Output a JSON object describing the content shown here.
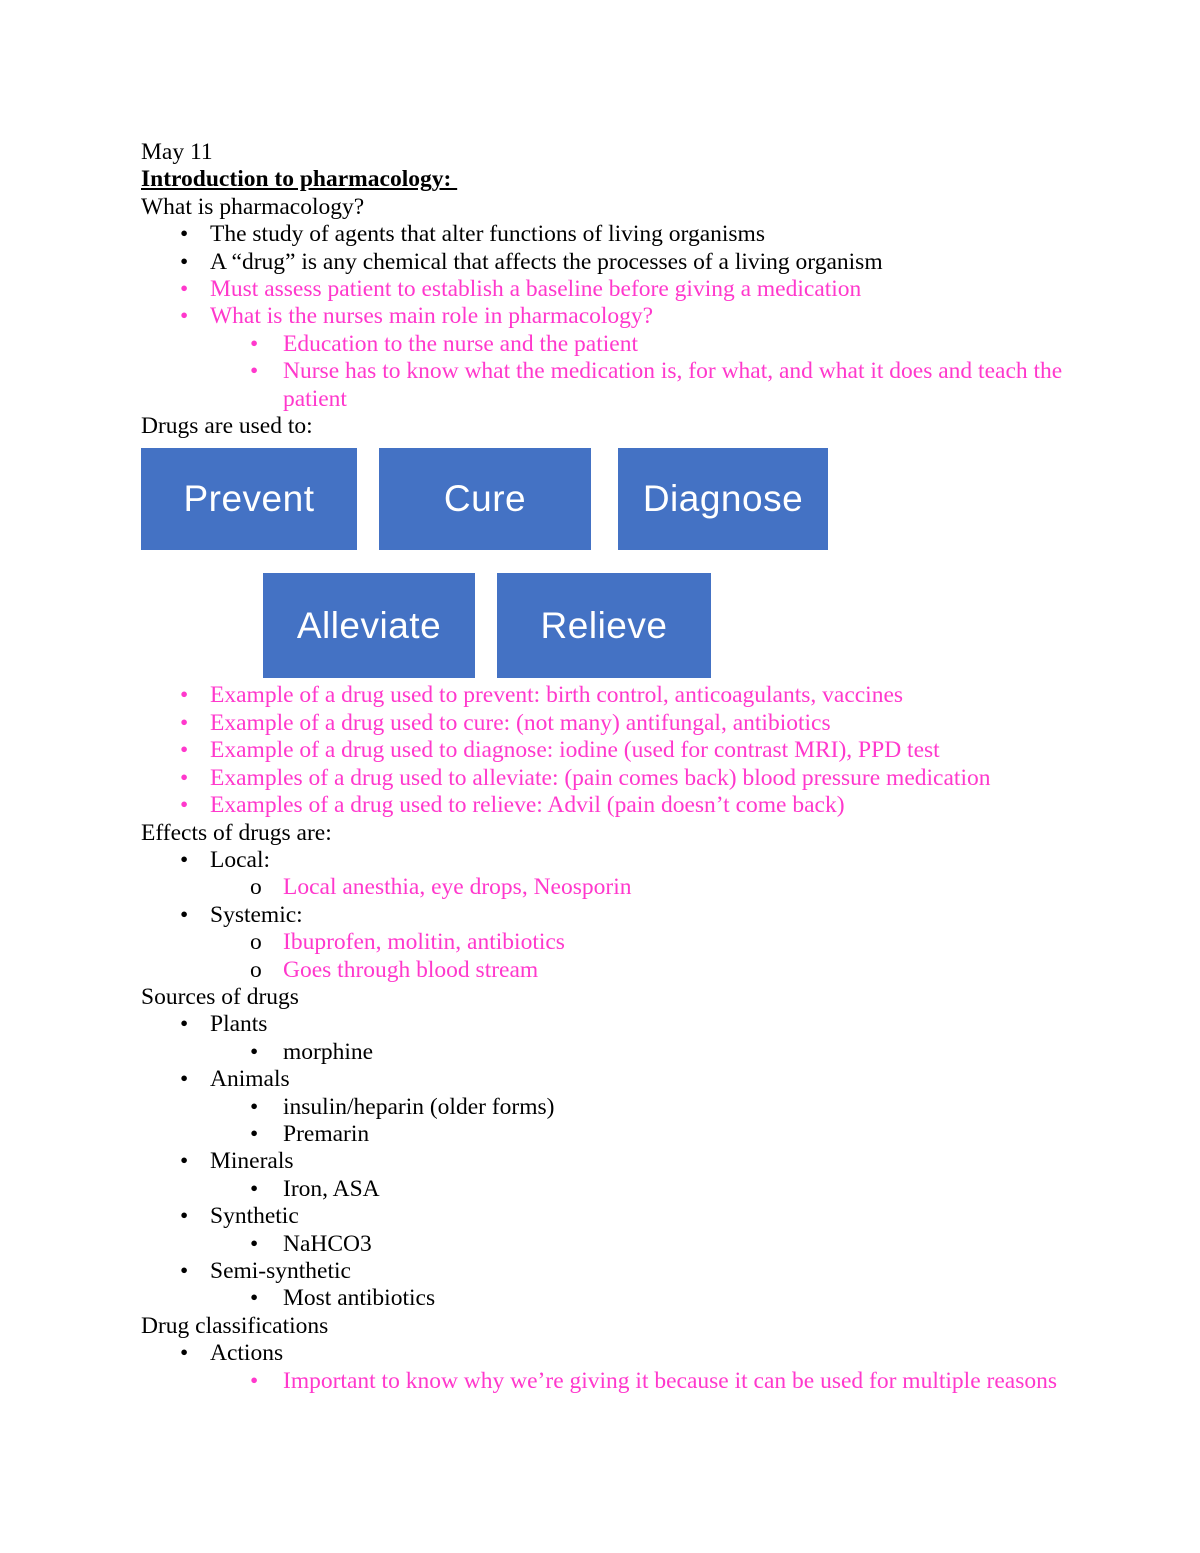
{
  "document": {
    "date_line": "May 11",
    "heading": "Introduction to pharmacology: ",
    "intro_question": "What is pharmacology?",
    "intro_bullets": [
      {
        "text": "The study of agents that alter functions of living organisms",
        "color": "black",
        "level": 1,
        "marker": "•"
      },
      {
        "text": "A “drug” is any chemical that affects the processes of a living organism",
        "color": "black",
        "level": 1,
        "marker": "•"
      },
      {
        "text": "Must assess patient to establish a baseline before giving a medication",
        "color": "pink",
        "level": 1,
        "marker": "•"
      },
      {
        "text": "What is the nurses main role in pharmacology?",
        "color": "pink",
        "level": 1,
        "marker": "•"
      },
      {
        "text": "Education to the nurse and the patient",
        "color": "pink",
        "level": 2,
        "marker": "•"
      },
      {
        "text": "Nurse has to know what the medication is, for what, and what it does and teach the patient",
        "color": "pink",
        "level": 2,
        "marker": "•"
      }
    ],
    "drugs_used_to_label": "Drugs are used to:",
    "diagram": {
      "accent_color": "#4472C4",
      "text_color": "#FFFFFF",
      "boxes": [
        {
          "label": "Prevent"
        },
        {
          "label": "Cure"
        },
        {
          "label": "Diagnose"
        },
        {
          "label": "Alleviate"
        },
        {
          "label": "Relieve"
        }
      ]
    },
    "example_bullets": [
      {
        "text": "Example of a drug used to prevent: birth control, anticoagulants, vaccines",
        "color": "pink",
        "level": 1,
        "marker": "•"
      },
      {
        "text": "Example of a drug used to cure: (not many) antifungal, antibiotics",
        "color": "pink",
        "level": 1,
        "marker": "•"
      },
      {
        "text": "Example of a drug used to diagnose: iodine (used for contrast MRI), PPD test",
        "color": "pink",
        "level": 1,
        "marker": "•"
      },
      {
        "text": "Examples of a drug used to alleviate: (pain comes back) blood pressure medication",
        "color": "pink",
        "level": 1,
        "marker": "•"
      },
      {
        "text": "Examples of a drug used to relieve: Advil (pain doesn’t come back)",
        "color": "pink",
        "level": 1,
        "marker": "•"
      }
    ],
    "effects_label": "Effects of drugs are:",
    "effects_bullets": [
      {
        "text": "Local:",
        "color": "black",
        "level": 1,
        "marker": "•"
      },
      {
        "text": "Local anesthia, eye drops, Neosporin",
        "color": "pink",
        "level": 2,
        "marker": "o"
      },
      {
        "text": "Systemic:",
        "color": "black",
        "level": 1,
        "marker": "•"
      },
      {
        "text": "Ibuprofen, molitin, antibiotics",
        "color": "pink",
        "level": 2,
        "marker": "o"
      },
      {
        "text": "Goes through blood stream",
        "color": "pink",
        "level": 2,
        "marker": "o"
      }
    ],
    "sources_label": "Sources of drugs",
    "sources_bullets": [
      {
        "text": "Plants",
        "color": "black",
        "level": 1,
        "marker": "•"
      },
      {
        "text": "morphine",
        "color": "black",
        "level": 2,
        "marker": "•"
      },
      {
        "text": "Animals",
        "color": "black",
        "level": 1,
        "marker": "•"
      },
      {
        "text": "insulin/heparin (older forms)",
        "color": "black",
        "level": 2,
        "marker": "•"
      },
      {
        "text": "Premarin",
        "color": "black",
        "level": 2,
        "marker": "•"
      },
      {
        "text": "Minerals",
        "color": "black",
        "level": 1,
        "marker": "•"
      },
      {
        "text": "Iron, ASA",
        "color": "black",
        "level": 2,
        "marker": "•"
      },
      {
        "text": "Synthetic",
        "color": "black",
        "level": 1,
        "marker": "•"
      },
      {
        "text": "NaHCO3",
        "color": "black",
        "level": 2,
        "marker": "•"
      },
      {
        "text": "Semi-synthetic",
        "color": "black",
        "level": 1,
        "marker": "•"
      },
      {
        "text": "Most antibiotics",
        "color": "black",
        "level": 2,
        "marker": "•"
      }
    ],
    "classifications_label": "Drug classifications",
    "classifications_bullets": [
      {
        "text": "Actions",
        "color": "black",
        "level": 1,
        "marker": "•"
      },
      {
        "text": "Important to know why we’re giving it because it can be used for multiple reasons",
        "color": "pink",
        "level": 2,
        "marker": "•"
      }
    ],
    "colors": {
      "highlight_pink": "#FF38CC",
      "body_black": "#000000",
      "diagram_blue": "#4472C4"
    }
  }
}
